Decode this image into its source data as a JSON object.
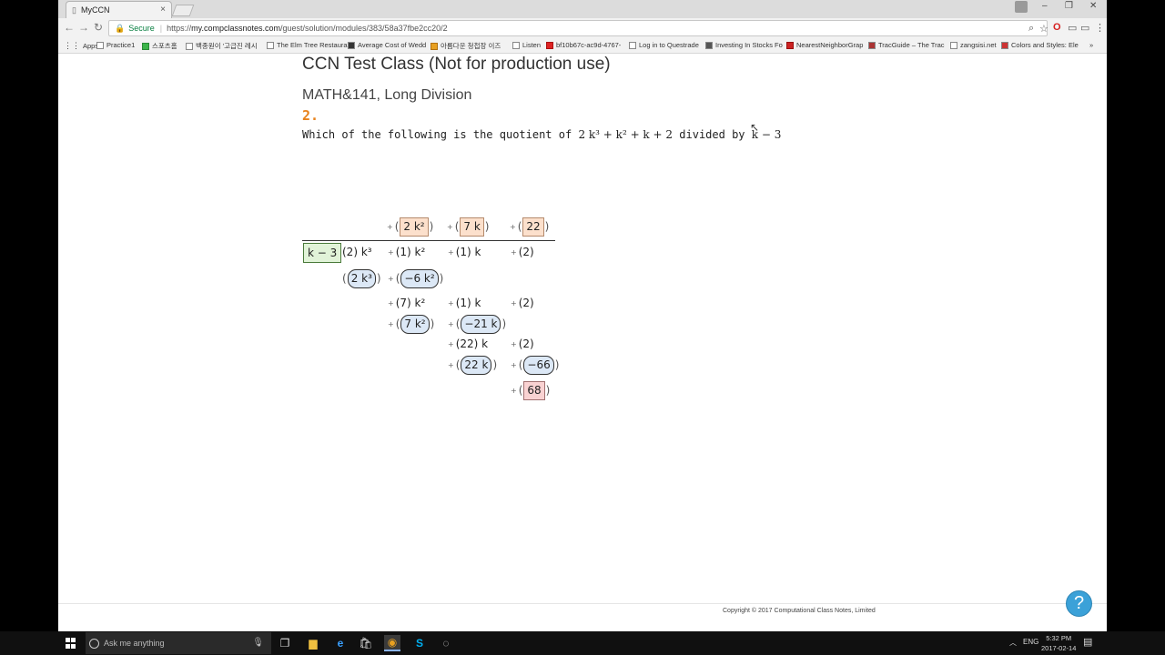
{
  "browser": {
    "tab_title": "MyCCN",
    "tab_close": "×",
    "secure_label": "Secure",
    "url_scheme": "https://",
    "url_host": "my.compclassnotes.com",
    "url_path": "/guest/solution/modules/383/58a37fbe2cc20/2",
    "window_controls": [
      "–",
      "❐",
      "✕"
    ],
    "nav": [
      "←",
      "→",
      "↻"
    ]
  },
  "bookmarks": [
    {
      "label": "Apps"
    },
    {
      "label": "Practice1"
    },
    {
      "label": "스포츠홈"
    },
    {
      "label": "백종원이 '고급진 레시"
    },
    {
      "label": "The Elm Tree Restaura"
    },
    {
      "label": "Average Cost of Wedd"
    },
    {
      "label": "아름다운 청첩장 이즈"
    },
    {
      "label": "Listen"
    },
    {
      "label": "bf10b67c-ac9d-4767-"
    },
    {
      "label": "Log in to Questrade"
    },
    {
      "label": "Investing In Stocks Fo"
    },
    {
      "label": "NearestNeighborGrap"
    },
    {
      "label": "TracGuide – The Trac"
    },
    {
      "label": "zangsisi.net"
    },
    {
      "label": "Colors and Styles: Ele"
    },
    {
      "label": "»"
    }
  ],
  "page": {
    "class_title": "CCN Test Class (Not for production use)",
    "module_title": "MATH&141, Long Division",
    "question_number": "2.",
    "question_prefix": "Which of the following is the quotient of",
    "question_poly": "2 k³ + k² + k + 2",
    "question_mid": "divided by",
    "question_divisor": "k − 3"
  },
  "division": {
    "plus": "+",
    "quotient": [
      "2 k²",
      "7 k",
      "22"
    ],
    "divisor": "k − 3",
    "dividend": [
      "(2) k³",
      "(1) k²",
      "(1) k",
      "(2)"
    ],
    "step1_sub": [
      "2 k³",
      "−6 k²"
    ],
    "step1_rem": [
      "(7) k²",
      "(1) k",
      "(2)"
    ],
    "step2_sub": [
      "7 k²",
      "−21 k"
    ],
    "step2_rem": [
      "(22) k",
      "(2)"
    ],
    "step3_sub": [
      "22 k",
      "−66"
    ],
    "remainder": "68"
  },
  "footer": {
    "copyright": "Copyright © 2017 Computational Class Notes, Limited",
    "help": "?"
  },
  "taskbar": {
    "search_placeholder": "Ask me anything",
    "language": "ENG",
    "time": "5:32 PM",
    "date": "2017-02-14"
  }
}
